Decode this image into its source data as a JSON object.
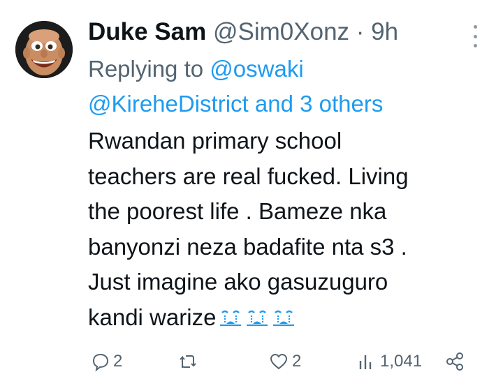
{
  "tweet": {
    "author_name": "Duke Sam",
    "handle": "@Sim0Xonz",
    "separator": "·",
    "time": "9h",
    "reply_prefix": "Replying to",
    "reply_user": "@oswaki",
    "reply_user2": "@KireheDistrict",
    "reply_and": "and",
    "reply_others": "3 others",
    "body_lines": [
      "Rwandan primary school",
      "teachers are real fucked. Living",
      "the poorest life . Bameze nka",
      "banyonzi neza badafite nta s3 .",
      "Just imagine ako gasuzuguro",
      "kandi warize"
    ],
    "emoji_count": 3,
    "emoji_name": "loudly-crying-face"
  },
  "actions": {
    "reply_count": "2",
    "retweet_count": "",
    "like_count": "2",
    "views_count": "1,041"
  },
  "icons": {
    "reply": "speech-bubble-icon",
    "retweet": "retweet-arrows-icon",
    "like": "heart-icon",
    "views": "bar-chart-icon",
    "share": "share-icon",
    "more": "more-vertical-icon"
  },
  "colors": {
    "link": "#1d9bf0",
    "muted": "#536471",
    "text": "#0f1419"
  }
}
